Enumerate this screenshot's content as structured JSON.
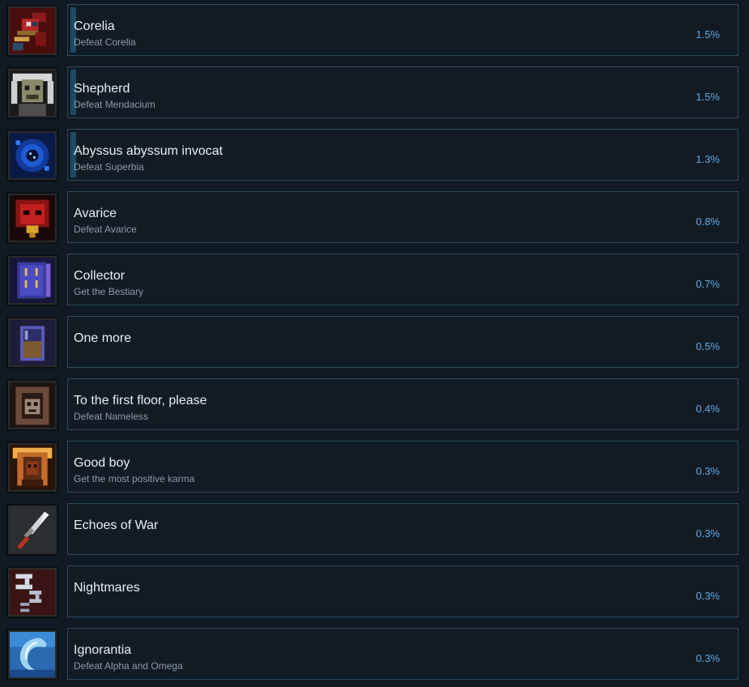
{
  "achievements": [
    {
      "title": "Corelia",
      "description": "Defeat Corelia",
      "percent": "1.5%",
      "icon": "corelia-icon",
      "progress": 0.015
    },
    {
      "title": "Shepherd",
      "description": "Defeat Mendacium",
      "percent": "1.5%",
      "icon": "shepherd-icon",
      "progress": 0.015
    },
    {
      "title": "Abyssus abyssum invocat",
      "description": "Defeat Superbia",
      "percent": "1.3%",
      "icon": "abyss-icon",
      "progress": 0.013
    },
    {
      "title": "Avarice",
      "description": "Defeat Avarice",
      "percent": "0.8%",
      "icon": "avarice-icon",
      "progress": 0.008
    },
    {
      "title": "Collector",
      "description": "Get the Bestiary",
      "percent": "0.7%",
      "icon": "bestiary-book-icon",
      "progress": 0.007
    },
    {
      "title": "One more",
      "description": "",
      "percent": "0.5%",
      "icon": "drink-glass-icon",
      "progress": 0.005
    },
    {
      "title": "To the first floor, please",
      "description": "Defeat Nameless",
      "percent": "0.4%",
      "icon": "hooded-skull-icon",
      "progress": 0.004
    },
    {
      "title": "Good boy",
      "description": "Get the most positive karma",
      "percent": "0.3%",
      "icon": "saint-icon",
      "progress": 0.003
    },
    {
      "title": "Echoes of War",
      "description": "",
      "percent": "0.3%",
      "icon": "dagger-icon",
      "progress": 0.003
    },
    {
      "title": "Nightmares",
      "description": "",
      "percent": "0.3%",
      "icon": "sleep-zzz-icon",
      "progress": 0.003
    },
    {
      "title": "Ignorantia",
      "description": "Defeat Alpha and Omega",
      "percent": "0.3%",
      "icon": "wave-icon",
      "progress": 0.003
    }
  ]
}
